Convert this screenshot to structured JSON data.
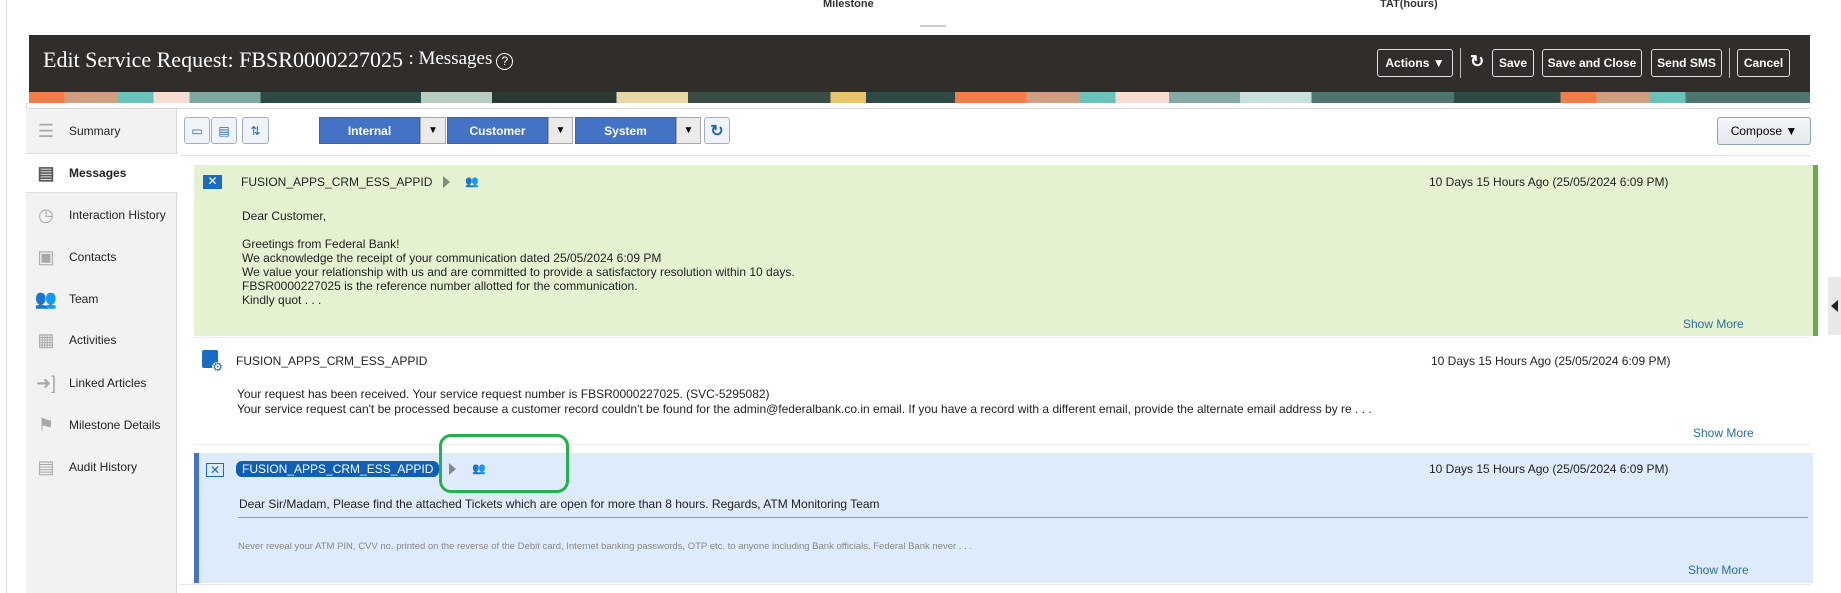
{
  "top_columns": {
    "milestone": "Milestone",
    "tat": "TAT(hours)"
  },
  "header": {
    "title_prefix": "Edit Service Request: FBSR0000227025",
    "title_suffix": ": Messages",
    "help": "?",
    "actions_label": "Actions ▼",
    "save_label": "Save",
    "save_close_label": "Save and Close",
    "send_sms_label": "Send SMS",
    "cancel_label": "Cancel"
  },
  "sidebar": {
    "items": [
      {
        "label": "Summary",
        "icon": "summary-icon"
      },
      {
        "label": "Messages",
        "icon": "messages-icon",
        "active": true
      },
      {
        "label": "Interaction History",
        "icon": "clock-icon"
      },
      {
        "label": "Contacts",
        "icon": "contacts-icon"
      },
      {
        "label": "Team",
        "icon": "team-icon"
      },
      {
        "label": "Activities",
        "icon": "activities-icon"
      },
      {
        "label": "Linked Articles",
        "icon": "linked-articles-icon"
      },
      {
        "label": "Milestone Details",
        "icon": "flag-icon"
      },
      {
        "label": "Audit History",
        "icon": "audit-icon"
      }
    ]
  },
  "toolbar": {
    "filters": [
      "Internal",
      "Customer",
      "System"
    ],
    "compose_label": "Compose ▼"
  },
  "messages": [
    {
      "sender": "FUSION_APPS_CRM_ESS_APPID",
      "timestamp": "10 Days 15 Hours Ago (25/05/2024 6:09 PM)",
      "lines": [
        "Dear Customer,",
        "",
        "Greetings from Federal Bank!",
        "We acknowledge the receipt of your communication dated 25/05/2024 6:09 PM",
        "We value your relationship with us and are committed to provide a satisfactory resolution within 10 days.",
        "FBSR0000227025 is the reference number allotted for the communication.",
        "Kindly quot . . ."
      ],
      "show_more": "Show More",
      "color": "#e4f2d2"
    },
    {
      "sender": "FUSION_APPS_CRM_ESS_APPID",
      "timestamp": "10 Days 15 Hours Ago (25/05/2024 6:09 PM)",
      "lines": [
        "Your request has been received. Your service request number is FBSR0000227025. (SVC-5295082)",
        "Your service request can't be processed because a customer record couldn't be found for the admin@federalbank.co.in email. If you have a record with a different email, provide the alternate email address by re . . ."
      ],
      "show_more": "Show More",
      "color": "#ffffff"
    },
    {
      "sender": "FUSION_APPS_CRM_ESS_APPID",
      "timestamp": "10 Days 15 Hours Ago (25/05/2024 6:09 PM)",
      "lines": [
        "Dear Sir/Madam, Please find the attached Tickets which are open for more than 8 hours. Regards, ATM Monitoring Team"
      ],
      "disclaimer": "Never reveal your ATM PIN, CVV no. printed on the reverse of the Debit card, Internet banking passwords, OTP etc. to anyone including Bank officials. Federal Bank never . . .",
      "show_more": "Show More",
      "color": "#ddebfb"
    }
  ]
}
